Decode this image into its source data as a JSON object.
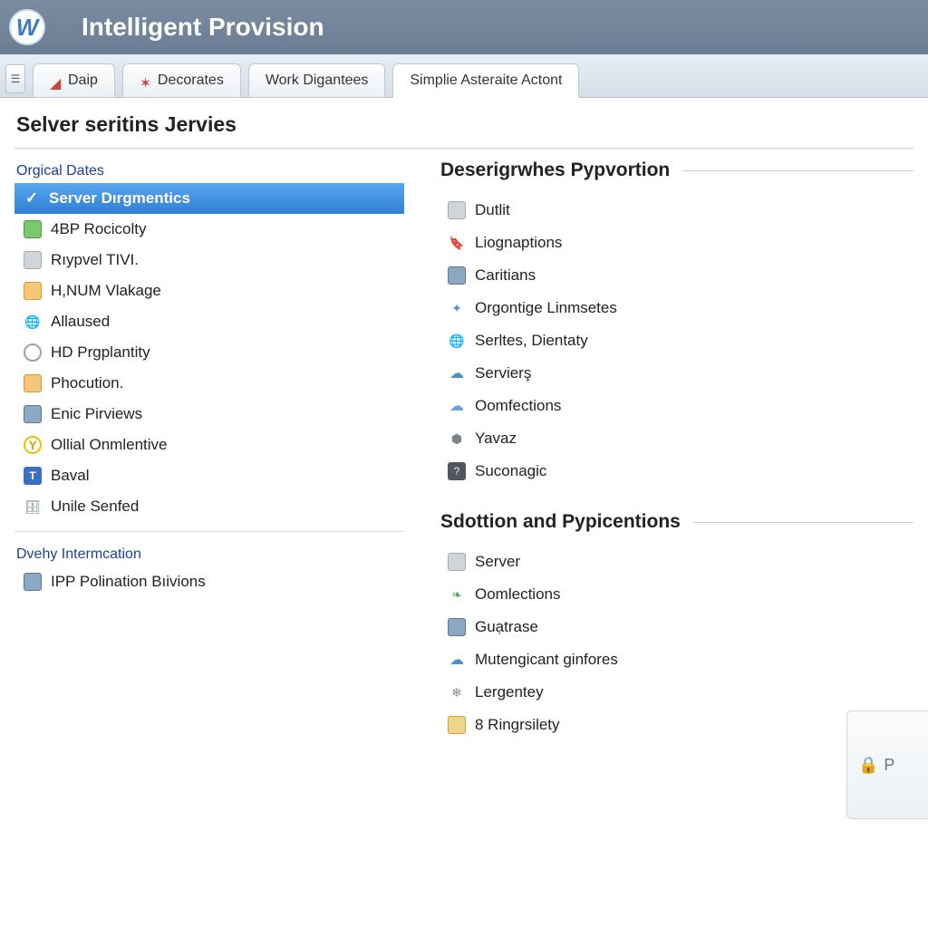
{
  "header": {
    "title": "Intelligent Provision",
    "logo_letter": "W"
  },
  "tabs": [
    {
      "label": "Daip"
    },
    {
      "label": "Decorates"
    },
    {
      "label": "Work Digantees"
    },
    {
      "label": "Simplie Asteraite Actont"
    }
  ],
  "page_title": "Selver seritins Jervies",
  "sidebar": {
    "cat1_header": "Orgical Dates",
    "cat1_items": [
      {
        "label": "Server Dırgmentics",
        "selected": true
      },
      {
        "label": "4BP Rocicolty"
      },
      {
        "label": "Rıypvel TIVI."
      },
      {
        "label": "H,NUM Vlakage"
      },
      {
        "label": "Allaused"
      },
      {
        "label": "HD Prgplantity"
      },
      {
        "label": "Phocution."
      },
      {
        "label": "Enic Pirviews"
      },
      {
        "label": "Ollial Onmlentive"
      },
      {
        "label": "Baval"
      },
      {
        "label": "Unile Senfed"
      }
    ],
    "cat2_header": "Dvehy Intermcation",
    "cat2_items": [
      {
        "label": "IPP Polination Bıivions"
      }
    ]
  },
  "main": {
    "group1_header": "Deserigrwhes Pypvortion",
    "group1_items": [
      {
        "label": "Dutlit"
      },
      {
        "label": "Liognaptions"
      },
      {
        "label": "Caritians"
      },
      {
        "label": "Orgontige Linmsetes"
      },
      {
        "label": "Serltes, Dientaty"
      },
      {
        "label": "Servierş"
      },
      {
        "label": "Oomfections"
      },
      {
        "label": "Yavaz"
      },
      {
        "label": "Suconagic"
      }
    ],
    "group2_header": "Sdottion and Pypicentions",
    "group2_items": [
      {
        "label": "Server"
      },
      {
        "label": "Oomlections"
      },
      {
        "label": "Guạtrase"
      },
      {
        "label": "Mutengicant ginfores"
      },
      {
        "label": "Lergentey"
      },
      {
        "label": "8 Ringrsilety"
      }
    ]
  },
  "side_panel_stub": "P"
}
